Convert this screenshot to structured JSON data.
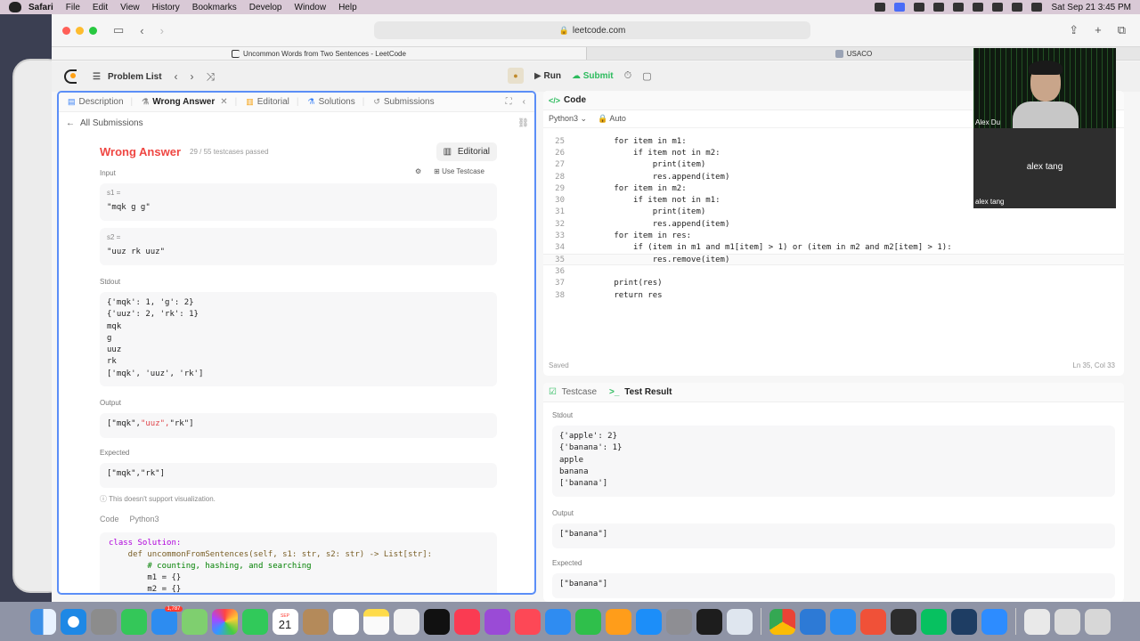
{
  "menubar": {
    "app": "Safari",
    "items": [
      "File",
      "Edit",
      "View",
      "History",
      "Bookmarks",
      "Develop",
      "Window",
      "Help"
    ],
    "datetime": "Sat Sep 21  3:45 PM"
  },
  "browser": {
    "url": "leetcode.com",
    "tabs": [
      {
        "title": "Uncommon Words from Two Sentences - LeetCode",
        "active": true
      },
      {
        "title": "USACO",
        "active": false
      }
    ]
  },
  "header": {
    "problem_list": "Problem List",
    "run": "Run",
    "submit": "Submit"
  },
  "left_tabs": [
    "Description",
    "Wrong Answer",
    "Editorial",
    "Solutions",
    "Submissions"
  ],
  "all_submissions": "All Submissions",
  "result": {
    "title": "Wrong Answer",
    "passed": "29 / 55 testcases passed",
    "editorial_btn": "Editorial",
    "input_label": "Input",
    "use_testcase": "Use Testcase",
    "s1_label": "s1 =",
    "s1_value": "\"mqk g g\"",
    "s2_label": "s2 =",
    "s2_value": "\"uuz rk uuz\"",
    "stdout_label": "Stdout",
    "stdout_lines": [
      "{'mqk': 1, 'g': 2}",
      "{'uuz': 2, 'rk': 1}",
      "mqk",
      "g",
      "uuz",
      "rk",
      "['mqk', 'uuz', 'rk']"
    ],
    "output_label": "Output",
    "output_pre": "[\"mqk\",",
    "output_diff": "\"uuz\",",
    "output_post": "\"rk\"]",
    "expected_label": "Expected",
    "expected_value": "[\"mqk\",\"rk\"]",
    "note": "This doesn't support visualization.",
    "code_label": "Code",
    "code_lang": "Python3",
    "code_lines": [
      "class Solution:",
      "    def uncommonFromSentences(self, s1: str, s2: str) -> List[str]:",
      "        # counting, hashing, and searching",
      "        m1 = {}",
      "        m2 = {}"
    ]
  },
  "editor": {
    "title": "Code",
    "lang": "Python3",
    "mode": "Auto",
    "lines": [
      {
        "n": "25",
        "t": "        for item in m1:"
      },
      {
        "n": "26",
        "t": "            if item not in m2:"
      },
      {
        "n": "27",
        "t": "                print(item)"
      },
      {
        "n": "28",
        "t": "                res.append(item)"
      },
      {
        "n": "29",
        "t": "        for item in m2:"
      },
      {
        "n": "30",
        "t": "            if item not in m1:"
      },
      {
        "n": "31",
        "t": "                print(item)"
      },
      {
        "n": "32",
        "t": "                res.append(item)"
      },
      {
        "n": "33",
        "t": "        for item in res:"
      },
      {
        "n": "34",
        "t": "            if (item in m1 and m1[item] > 1) or (item in m2 and m2[item] > 1):"
      },
      {
        "n": "35",
        "t": "                res.remove(item)"
      },
      {
        "n": "36",
        "t": ""
      },
      {
        "n": "37",
        "t": "        print(res)"
      },
      {
        "n": "38",
        "t": "        return res"
      }
    ],
    "saved": "Saved",
    "cursor": "Ln 35, Col 33"
  },
  "test": {
    "tab_testcase": "Testcase",
    "tab_result": "Test Result",
    "stdout_label": "Stdout",
    "stdout_lines": [
      "{'apple': 2}",
      "{'banana': 1}",
      "apple",
      "banana",
      "['banana']"
    ],
    "output_label": "Output",
    "output_value": "[\"banana\"]",
    "expected_label": "Expected",
    "expected_value": "[\"banana\"]"
  },
  "video": {
    "name_top": "Alex Du",
    "name_center": "alex tang",
    "name_bottom": "alex tang"
  },
  "dock": {
    "calendar_month": "SEP",
    "calendar_day": "21",
    "badge_mail": "1,787"
  }
}
